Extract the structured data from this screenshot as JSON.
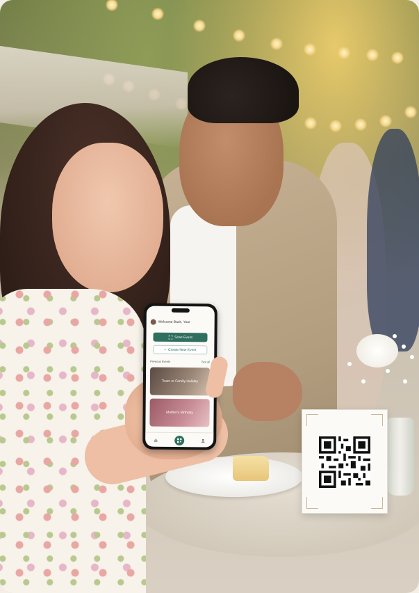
{
  "phone_app": {
    "welcome_text": "Welcome Back, Your",
    "scan_button": "Scan Event",
    "create_button": "Create New Event",
    "section_title": "Previous Events",
    "see_all": "See all",
    "events": [
      {
        "title": "Team or Family Holiday"
      },
      {
        "title": "Mother's Birthday"
      }
    ],
    "tabs": [
      "",
      "",
      ""
    ],
    "colors": {
      "accent": "#2f6f5e",
      "screen_bg": "#fbfaf7"
    }
  },
  "table_card": {
    "content": "qr-code-icon"
  },
  "colors": {
    "string_lights": "#f7d78a",
    "jacket": "#b9a484",
    "dress": "#f7f2ea"
  }
}
